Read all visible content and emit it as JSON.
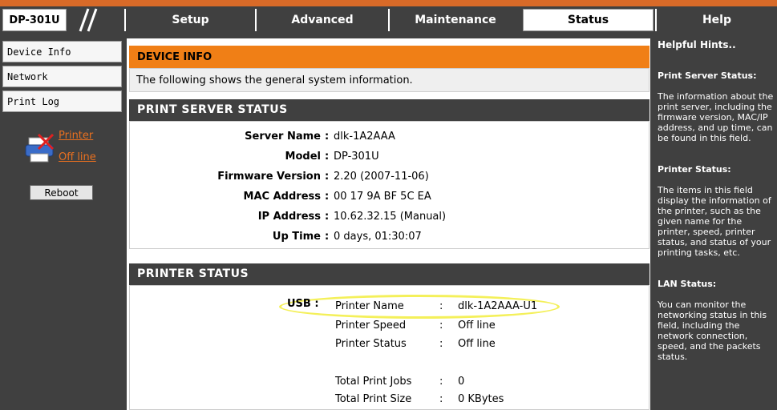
{
  "header": {
    "brand": "DP-301U",
    "tabs": [
      {
        "label": "Setup"
      },
      {
        "label": "Advanced"
      },
      {
        "label": "Maintenance"
      },
      {
        "label": "Status"
      },
      {
        "label": "Help"
      }
    ],
    "active_tab": "Status"
  },
  "sidebar": {
    "items": [
      {
        "label": "Device Info"
      },
      {
        "label": "Network"
      },
      {
        "label": "Print Log"
      }
    ],
    "printer_link": "Printer",
    "offline_link": "Off line",
    "reboot_label": "Reboot"
  },
  "main": {
    "device_info_title": "DEVICE INFO",
    "device_info_desc": "The following shows the general system information.",
    "print_server_title": "PRINT SERVER STATUS",
    "print_server": [
      {
        "label": "Server Name",
        "value": "dlk-1A2AAA"
      },
      {
        "label": "Model",
        "value": "DP-301U"
      },
      {
        "label": "Firmware Version",
        "value": "2.20 (2007-11-06)"
      },
      {
        "label": "MAC Address",
        "value": "00 17 9A BF 5C EA"
      },
      {
        "label": "IP Address",
        "value": "10.62.32.15 (Manual)"
      },
      {
        "label": "Up Time",
        "value": "0 days, 01:30:07"
      }
    ],
    "printer_status_title": "PRINTER STATUS",
    "usb_label": "USB",
    "printer_rows": [
      {
        "label": "Printer Name",
        "value": "dlk-1A2AAA-U1"
      },
      {
        "label": "Printer Speed",
        "value": "Off line"
      },
      {
        "label": "Printer Status",
        "value": "Off line"
      },
      {
        "label": "Total Print Jobs",
        "value": "0"
      },
      {
        "label": "Total Print Size",
        "value": "0 KBytes"
      }
    ]
  },
  "hints": {
    "title": "Helpful Hints..",
    "sections": [
      {
        "heading": "Print Server Status:",
        "body": "The information about the print server, including the firmware version, MAC/IP address, and up time, can be found in this field."
      },
      {
        "heading": "Printer Status:",
        "body": "The items in this field display the information of the printer, such as the given name for the printer, speed, printer status, and status of your printing tasks, etc."
      },
      {
        "heading": "LAN Status:",
        "body": "You can monitor the networking status in this field, including the network connection, speed, and the packets status."
      }
    ]
  }
}
